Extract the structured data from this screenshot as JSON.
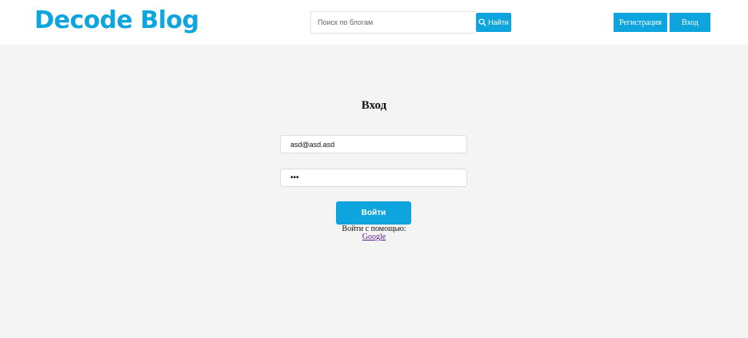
{
  "header": {
    "logo": "Decode Blog",
    "search": {
      "placeholder": "Поиск по блогам",
      "value": "",
      "button_label": "Найти",
      "icon": "search-icon"
    },
    "register_label": "Регистрация",
    "login_label": "Вход"
  },
  "login_form": {
    "title": "Вход",
    "email_value": "asd@asd.asd",
    "password_value": "•••",
    "submit_label": "Войти",
    "social_label": "Войти с помощью:",
    "google_label": "Google"
  },
  "colors": {
    "accent": "#0ea5de",
    "background": "#f4f4f4",
    "header_background": "#ffffff",
    "link_visited": "#551a8b"
  }
}
